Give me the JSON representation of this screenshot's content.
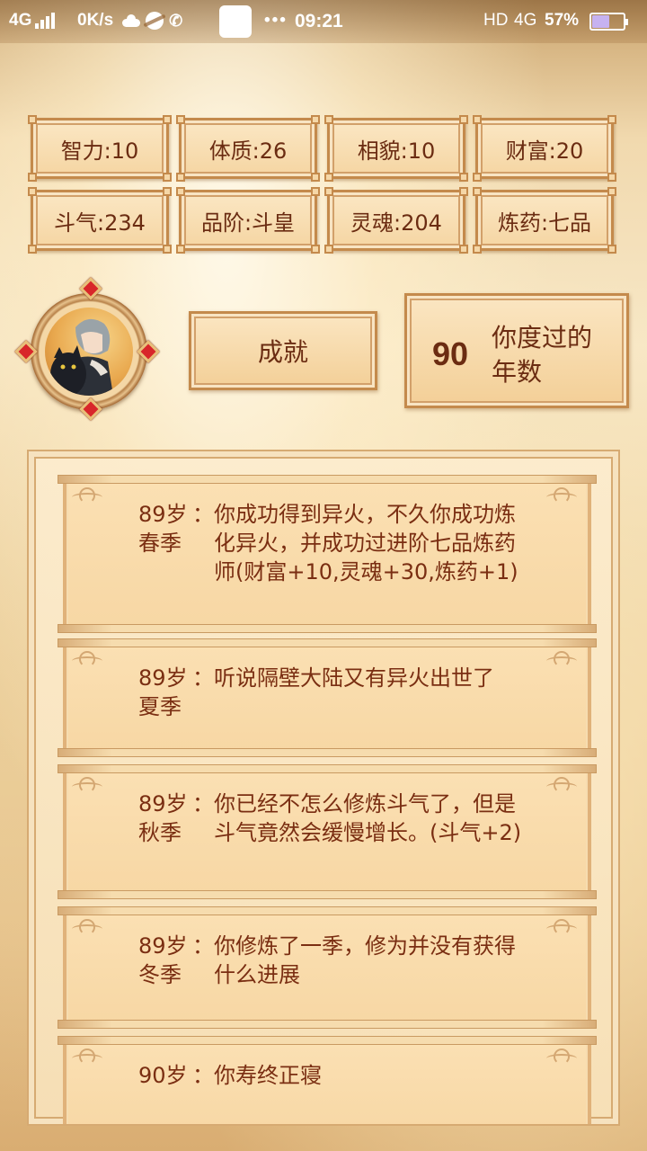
{
  "status_bar": {
    "network": "4G",
    "speed": "0K/s",
    "time": "09:21",
    "hd": "HD",
    "network_right": "4G",
    "battery": "57%",
    "battery_level": 0.57,
    "icons": [
      "signal-icon",
      "cloud-icon",
      "browser-icon",
      "phone-icon",
      "more-icon",
      "battery-icon"
    ]
  },
  "stats": [
    {
      "label": "智力:10"
    },
    {
      "label": "体质:26"
    },
    {
      "label": "相貌:10"
    },
    {
      "label": "财富:20"
    },
    {
      "label": "斗气:234"
    },
    {
      "label": "品阶:斗皇"
    },
    {
      "label": "灵魂:204"
    },
    {
      "label": "炼药:七品"
    }
  ],
  "achievement_button": "成就",
  "years": {
    "value": "90",
    "label": "你度过的年数"
  },
  "log": [
    {
      "age": "89岁",
      "season": "春季",
      "colon": "：",
      "text": "你成功得到异火，不久你成功炼化异火，并成功过进阶七品炼药师(财富+10,灵魂+30,炼药+1)"
    },
    {
      "age": "89岁",
      "season": "夏季",
      "colon": "：",
      "text": "听说隔壁大陆又有异火出世了"
    },
    {
      "age": "89岁",
      "season": "秋季",
      "colon": "：",
      "text": "你已经不怎么修炼斗气了，但是斗气竟然会缓慢增长。(斗气+2)"
    },
    {
      "age": "89岁",
      "season": "冬季",
      "colon": "：",
      "text": "你修炼了一季，修为并没有获得什么进展"
    },
    {
      "age": "90岁",
      "season": "",
      "colon": "：",
      "text": "你寿终正寝"
    }
  ]
}
